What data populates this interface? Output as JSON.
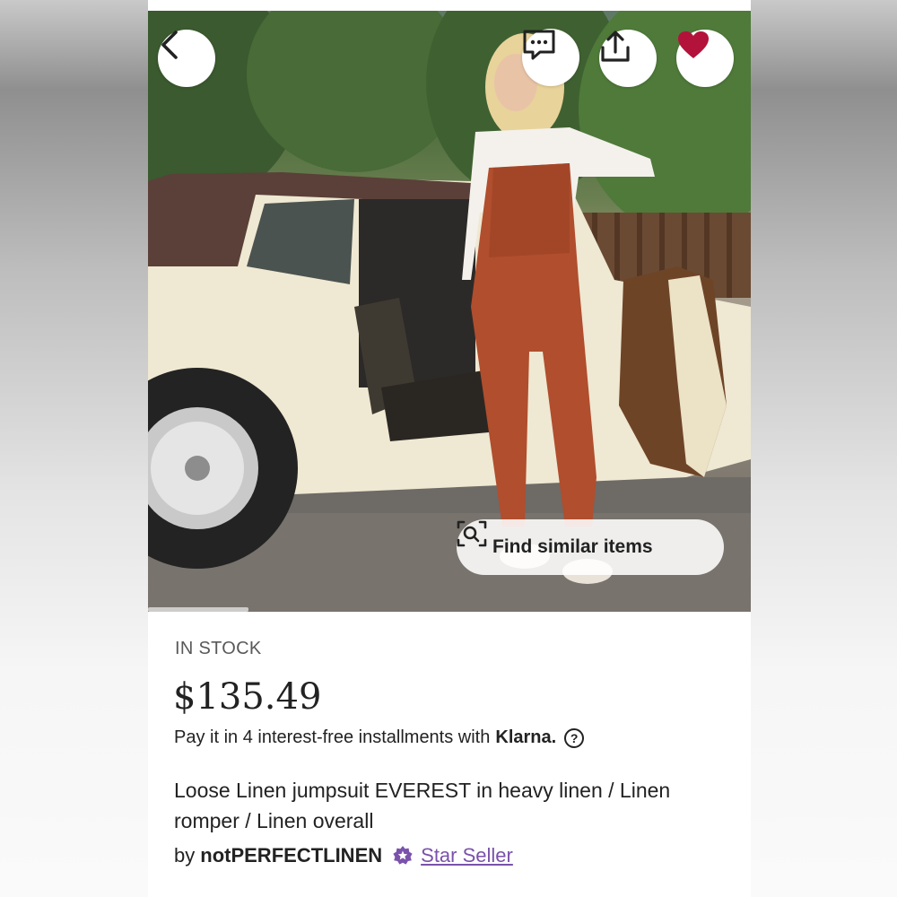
{
  "colors": {
    "accent_heart": "#b3123b",
    "star_seller_purple": "#7b52ab",
    "text_primary": "#222222",
    "text_muted": "#595959"
  },
  "header": {
    "back_icon": "chevron-left-icon",
    "message_icon": "message-bubble-icon",
    "share_icon": "share-icon",
    "favorite_icon": "heart-filled-icon"
  },
  "image": {
    "find_similar_label": "Find similar items",
    "find_similar_icon": "visual-search-icon"
  },
  "listing": {
    "stock_status": "IN STOCK",
    "price": "$135.49",
    "installments_text": "Pay it in 4 interest-free installments with",
    "klarna_label": "Klarna.",
    "help_icon_glyph": "?",
    "title": "Loose Linen jumpsuit EVEREST in heavy linen / Linen romper / Linen overall",
    "by_label": "by",
    "seller_name": "notPERFECTLINEN",
    "star_seller_label": "Star Seller"
  }
}
